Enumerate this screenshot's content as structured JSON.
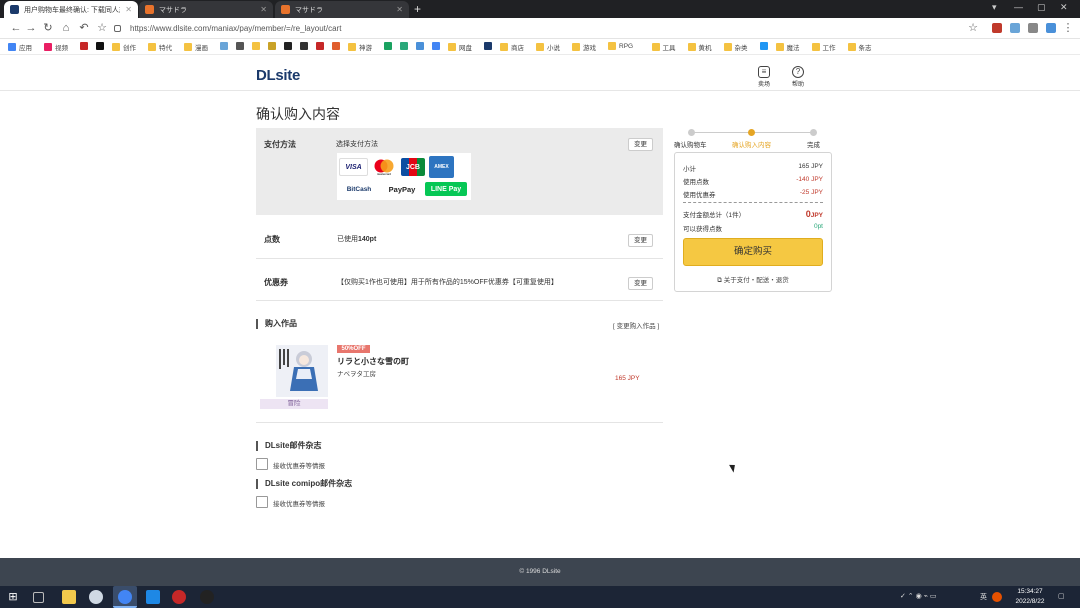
{
  "browser": {
    "tabs": [
      {
        "title": "用户购物车最终确认: 下载同人志",
        "favicon": "#1b3a6b"
      },
      {
        "title": "マサドラ",
        "favicon": "#e8732c"
      },
      {
        "title": "マサドラ",
        "favicon": "#e8732c"
      }
    ],
    "url": "https://www.dlsite.com/maniax/pay/member/=/re_layout/cart",
    "bookmarks": [
      "应用",
      "视频",
      "",
      "",
      "创作",
      "特代",
      "漫画",
      "",
      "",
      "",
      "",
      "",
      "",
      "",
      "",
      "神游",
      "",
      "",
      "",
      "",
      "网盘",
      "",
      "商店",
      "小说",
      "游戏",
      "RPG",
      "工具",
      "黄机",
      "杂类",
      "",
      "魔法",
      "工作",
      "条志"
    ]
  },
  "header": {
    "logo": "DLsite",
    "shop_label": "卖场",
    "help_label": "帮助"
  },
  "main": {
    "page_title": "确认购入内容",
    "payment": {
      "label": "支付方法",
      "value": "选择支付方法",
      "change": "变更",
      "cards": [
        "VISA",
        "mastercard",
        "JCB",
        "AMEX",
        "BitCash",
        "PayPay",
        "LINE Pay"
      ]
    },
    "points": {
      "label": "点数",
      "prefix": "已使用",
      "value": "140pt",
      "change": "变更"
    },
    "coupon": {
      "label": "优惠券",
      "value": "【仅购买1作也可使用】用于所有作品的15%OFF优惠券【可重复使用】",
      "change": "变更"
    },
    "works": {
      "heading": "购入作品",
      "change_link": "[ 变更购入作品 ]",
      "items": [
        {
          "discount": "50%OFF",
          "title": "リラと小さな雪の町",
          "circle": "ナベヲタ工房",
          "genre": "冒险",
          "price": "165 JPY"
        }
      ]
    },
    "newsletters": [
      {
        "heading": "DLsite邮件杂志",
        "label": "接收优惠券等情报"
      },
      {
        "heading": "DLsite comipo邮件杂志",
        "label": "接收优惠券等情报"
      }
    ]
  },
  "steps": [
    {
      "label": "确认购物车",
      "active": false
    },
    {
      "label": "确认购入内容",
      "active": true
    },
    {
      "label": "完成",
      "active": false
    }
  ],
  "summary": {
    "subtotal_label": "小计",
    "subtotal": "165 JPY",
    "points_label": "使用点数",
    "points": "-140 JPY",
    "coupon_label": "使用优惠券",
    "coupon": "-25 JPY",
    "total_label": "支付金额总计（1件）",
    "total_num": "0",
    "total_unit": "JPY",
    "earn_label": "可以获得点数",
    "earn": "0pt",
    "buy_button": "确定购买",
    "about_link": "关于支付・配送・退货"
  },
  "footer": {
    "copyright": "© 1996 DLsite"
  },
  "taskbar": {
    "time": "15:34:27",
    "date": "2022/8/22",
    "ime": "英"
  },
  "colors": {
    "accent": "#e5a524",
    "price": "#c0392b",
    "footer": "#3d4550",
    "brand": "#1b3a6b"
  }
}
